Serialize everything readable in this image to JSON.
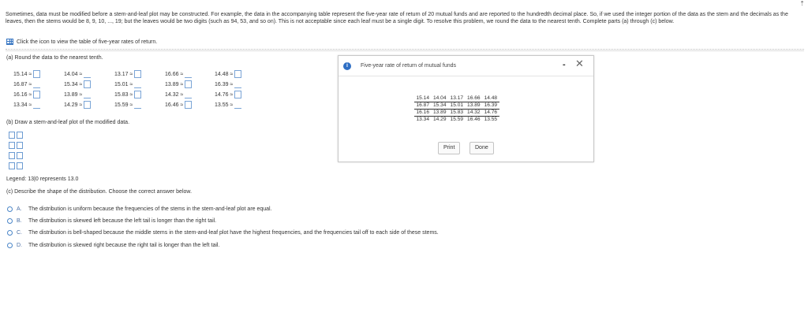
{
  "intro_text": "Sometimes, data must be modified before a stem-and-leaf plot may be constructed. For example, the data in the accompanying table represent the five-year rate of return of 20 mutual funds and are reported to the hundredth decimal place. So, if we used the integer portion of the data as the stem and the decimals as the leaves, then the stems would be 8, 9, 10, ..., 19; but the leaves would be two digits (such as 94, 53, and so on). This is not acceptable since each leaf must be a single digit. To resolve this problem, we round the data to the nearest tenth. Complete parts (a) through (c) below.",
  "icon_link": "Click the icon to view the table of five-year rates of return.",
  "part_a": {
    "label": "(a) Round the data to the nearest tenth.",
    "rows": [
      [
        "15.14 ≈",
        "14.04 ≈",
        "13.17 ≈",
        "16.66 ≈",
        "14.48 ≈"
      ],
      [
        "16.87 ≈",
        "15.34 ≈",
        "15.01 ≈",
        "13.89 ≈",
        "16.39 ≈"
      ],
      [
        "16.16 ≈",
        "13.89 ≈",
        "15.83 ≈",
        "14.32 ≈",
        "14.76 ≈"
      ],
      [
        "13.34 ≈",
        "14.29 ≈",
        "15.59 ≈",
        "16.46 ≈",
        "13.55 ≈"
      ]
    ]
  },
  "part_b": {
    "label": "(b) Draw a stem-and-leaf plot of the modified data."
  },
  "legend": "Legend: 13|0 represents 13.0",
  "part_c": {
    "label": "(c) Describe the shape of the distribution. Choose the correct answer below.",
    "options": [
      {
        "letter": "A.",
        "text": "The distribution is uniform because the frequencies of the stems in the stem-and-leaf plot are equal."
      },
      {
        "letter": "B.",
        "text": "The distribution is skewed left because the left tail is longer than the right tail."
      },
      {
        "letter": "C.",
        "text": "The distribution is bell-shaped because the middle stems in the stem-and-leaf plot have the highest frequencies, and the frequencies tail off to each side of these stems."
      },
      {
        "letter": "D.",
        "text": "The distribution is skewed right because the right tail is longer than the left tail."
      }
    ]
  },
  "dialog": {
    "title": "Five-year rate of return of mutual funds",
    "info_glyph": "i",
    "minimize_glyph": "-",
    "close_glyph": "✕",
    "table": [
      [
        "15.14",
        "14.04",
        "13.17",
        "16.66",
        "14.48"
      ],
      [
        "16.87",
        "15.34",
        "15.01",
        "13.89",
        "16.39"
      ],
      [
        "16.16",
        "13.89",
        "15.83",
        "14.32",
        "14.76"
      ],
      [
        "13.34",
        "14.29",
        "15.59",
        "16.46",
        "13.55"
      ]
    ],
    "print_label": "Print",
    "done_label": "Done"
  },
  "corner_glyph": "⇡"
}
